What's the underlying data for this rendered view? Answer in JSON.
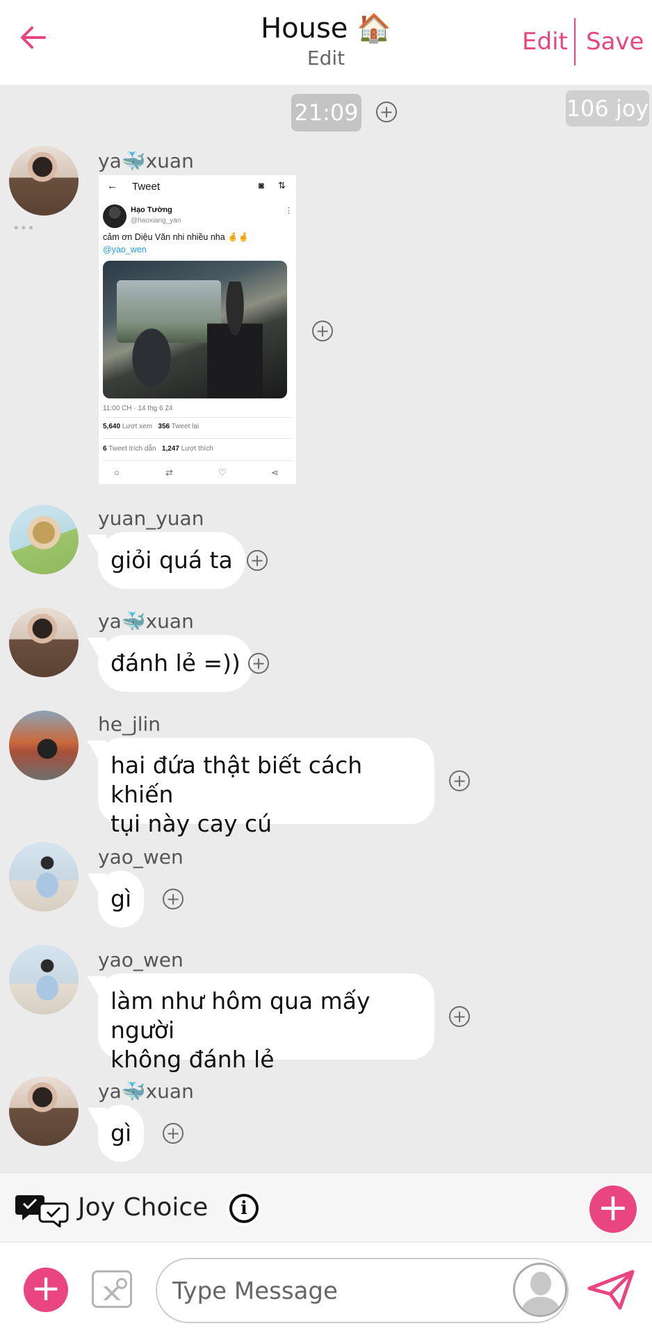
{
  "header": {
    "title": "House 🏠",
    "subtitle": "Edit",
    "edit_label": "Edit",
    "save_label": "Save",
    "accent_color": "#e94581"
  },
  "time_marker": "21:09",
  "joy_count": "106 joy",
  "messages": [
    {
      "sender": "ya🐳xuan",
      "type": "image",
      "tweet": {
        "bar_title": "Tweet",
        "author_name": "Hạo Tường",
        "author_handle": "@haoxiang_yan",
        "text": "cảm ơn Diệu Văn nhi nhiều nha 🤞🤞",
        "mention": "@yao_wen",
        "meta": "11:00 CH · 14 thg 6 24",
        "views": "5,640",
        "views_label": "Lượt xem",
        "retweets": "356",
        "retweets_label": "Tweet lại",
        "quotes": "6",
        "quotes_label": "Tweet trích dẫn",
        "likes": "1,247",
        "likes_label": "Lượt thích"
      }
    },
    {
      "sender": "yuan_yuan",
      "text": "giỏi quá ta"
    },
    {
      "sender": "ya🐳xuan",
      "text": "đánh lẻ =))"
    },
    {
      "sender": "he_jlin",
      "line1": "hai đứa thật biết cách khiến",
      "line2": "tụi này cay cú"
    },
    {
      "sender": "yao_wen",
      "text": "gì"
    },
    {
      "sender": "yao_wen",
      "line1": "làm như hôm qua mấy người",
      "line2": "không đánh lẻ"
    },
    {
      "sender": "ya🐳xuan",
      "text": "gì"
    }
  ],
  "joy_choice": {
    "label": "Joy Choice"
  },
  "composer": {
    "placeholder": "Type Message"
  }
}
